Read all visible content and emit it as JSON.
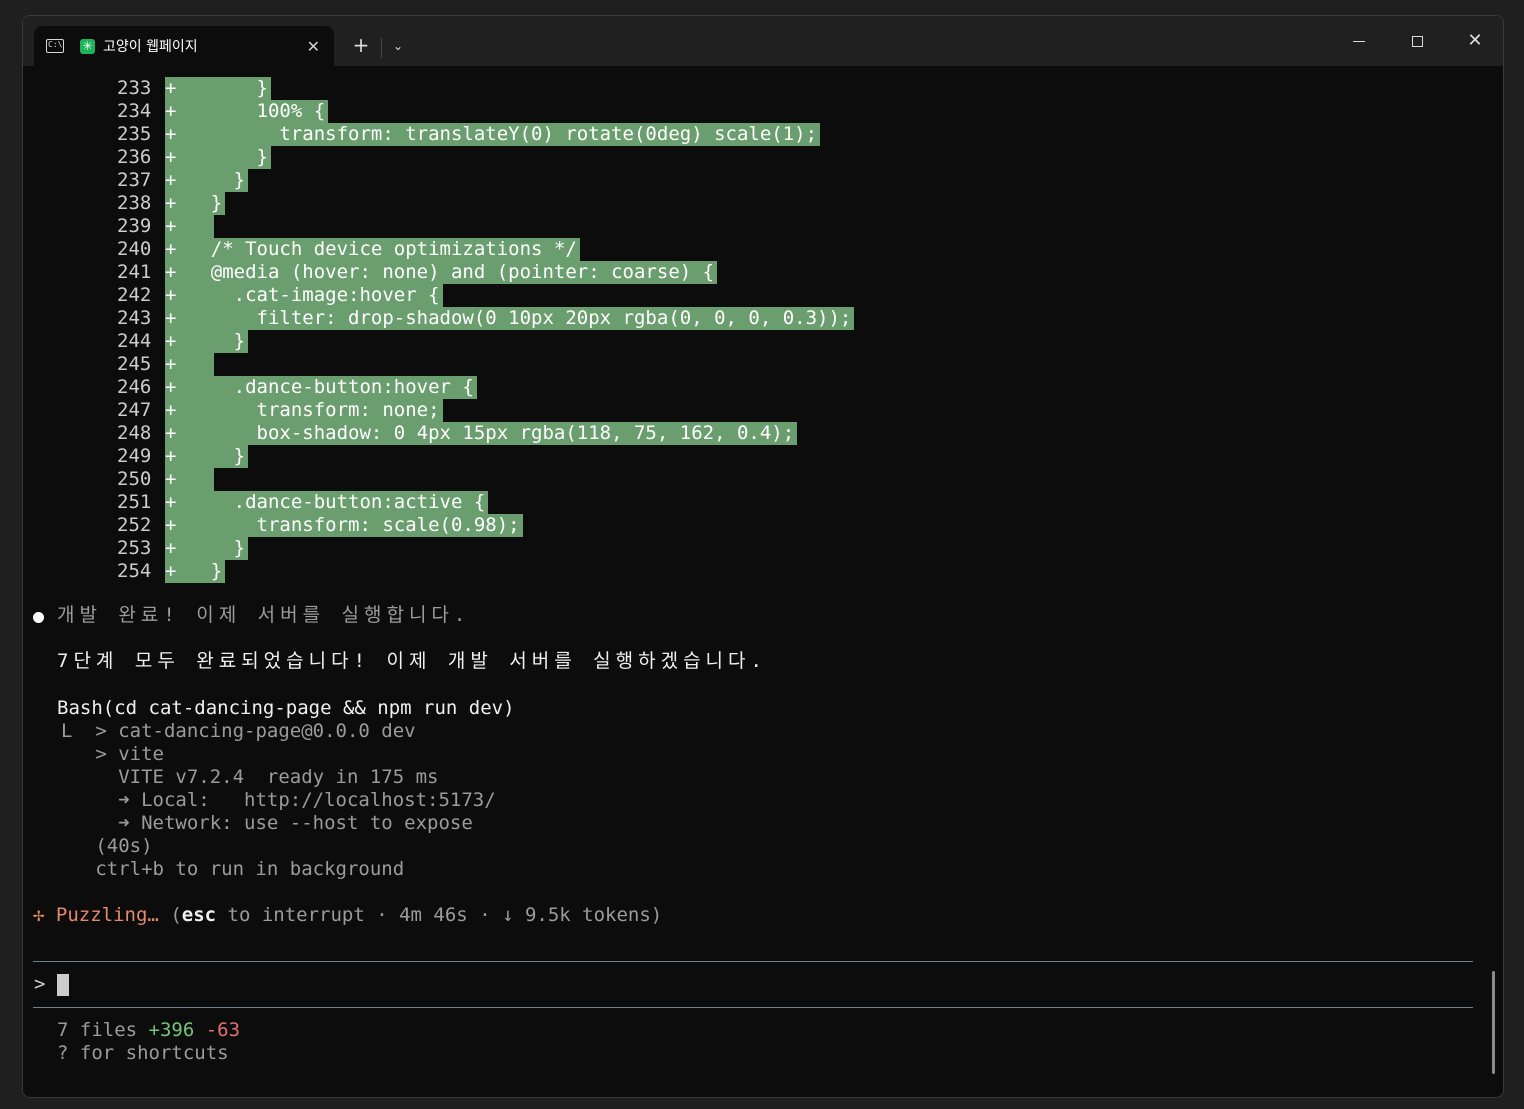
{
  "window": {
    "tab_title": "고양이 웹페이지",
    "tab_close": "✕",
    "new_tab": "+",
    "dropdown": "⌄",
    "terminal_icon_text": "C:\\",
    "app_icon_text": "✳",
    "close_glyph": "✕"
  },
  "diff": [
    {
      "num": "233",
      "code": "+       }"
    },
    {
      "num": "234",
      "code": "+       100% {"
    },
    {
      "num": "235",
      "code": "+         transform: translateY(0) rotate(0deg) scale(1);"
    },
    {
      "num": "236",
      "code": "+       }"
    },
    {
      "num": "237",
      "code": "+     }"
    },
    {
      "num": "238",
      "code": "+   }"
    },
    {
      "num": "239",
      "code": "+   "
    },
    {
      "num": "240",
      "code": "+   /* Touch device optimizations */"
    },
    {
      "num": "241",
      "code": "+   @media (hover: none) and (pointer: coarse) {"
    },
    {
      "num": "242",
      "code": "+     .cat-image:hover {"
    },
    {
      "num": "243",
      "code": "+       filter: drop-shadow(0 10px 20px rgba(0, 0, 0, 0.3));"
    },
    {
      "num": "244",
      "code": "+     }"
    },
    {
      "num": "245",
      "code": "+   "
    },
    {
      "num": "246",
      "code": "+     .dance-button:hover {"
    },
    {
      "num": "247",
      "code": "+       transform: none;"
    },
    {
      "num": "248",
      "code": "+       box-shadow: 0 4px 15px rgba(118, 75, 162, 0.4);"
    },
    {
      "num": "249",
      "code": "+     }"
    },
    {
      "num": "250",
      "code": "+   "
    },
    {
      "num": "251",
      "code": "+     .dance-button:active {"
    },
    {
      "num": "252",
      "code": "+       transform: scale(0.98);"
    },
    {
      "num": "253",
      "code": "+     }"
    },
    {
      "num": "254",
      "code": "+   }"
    }
  ],
  "message": {
    "status": "개발 완료! 이제 서버를 실행합니다.",
    "summary": "7단계 모두 완료되었습니다! 이제 개발 서버를 실행하겠습니다."
  },
  "bash": {
    "command": "Bash(cd cat-dancing-page && npm run dev)",
    "output": [
      "L  > cat-dancing-page@0.0.0 dev",
      "   > vite",
      "     VITE v7.2.4  ready in 175 ms",
      "     ➜ Local:   http://localhost:5173/",
      "     ➜ Network: use --host to expose",
      "   (40s)",
      "   ctrl+b to run in background"
    ]
  },
  "spinner": {
    "glyph": "✢",
    "label": "Puzzling…",
    "paren_open": "(",
    "esc": "esc",
    "rest": " to interrupt · 4m 46s · ↓ 9.5k tokens)"
  },
  "input": {
    "prompt": ">"
  },
  "footer": {
    "files": "7 files ",
    "added": "+396",
    "removed": "-63",
    "shortcuts": "? for shortcuts"
  },
  "colors": {
    "diff_added_bg": "#6b9e6f",
    "spinner": "#e5896b",
    "added": "#75c47a",
    "removed": "#e07070"
  }
}
